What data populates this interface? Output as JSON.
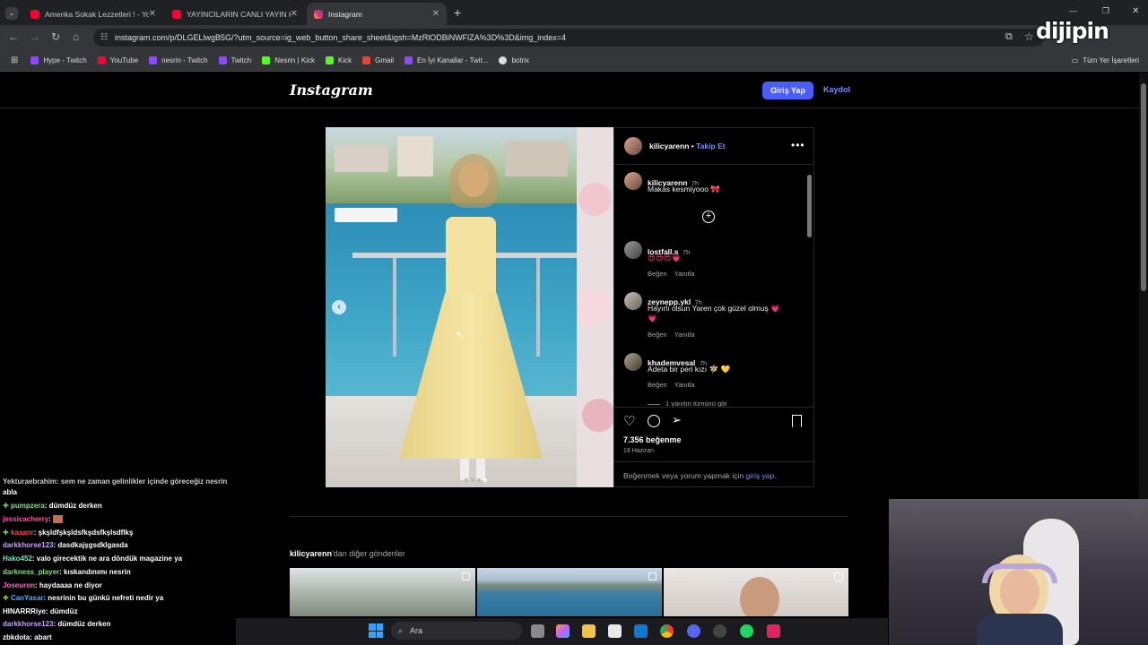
{
  "browser": {
    "tabs": [
      {
        "title": "Amerika Sokak Lezzetleri ! - You",
        "favicon_color": "#ff0033"
      },
      {
        "title": "YAYINCILARIN CANLI YAYIN KAZ",
        "favicon_color": "#ff0033"
      },
      {
        "title": "Instagram",
        "favicon_color": "#e1306c"
      }
    ],
    "url": "instagram.com/p/DLGELlwgB5G/?utm_source=ig_web_button_share_sheet&igsh=MzRlODBiNWFlZA%3D%3D&img_index=4",
    "bookmarks": [
      {
        "label": "Hype - Twitch",
        "color": "#9146ff"
      },
      {
        "label": "YouTube",
        "color": "#ff0033"
      },
      {
        "label": "nesrin - Twitch",
        "color": "#9146ff"
      },
      {
        "label": "Twitch",
        "color": "#9146ff"
      },
      {
        "label": "Nesrin | Kick",
        "color": "#53fc18"
      },
      {
        "label": "Kick",
        "color": "#53fc18"
      },
      {
        "label": "Gmail",
        "color": "#ea4335"
      },
      {
        "label": "En İyi Kanallar - Twit...",
        "color": "#9146ff"
      },
      {
        "label": "botrix",
        "color": "#dddddd"
      }
    ],
    "all_bookmarks": "Tüm Yer İşaretleri",
    "watermark": "dijipin"
  },
  "instagram": {
    "logo": "Instagram",
    "login_label": "Giriş Yap",
    "signup_label": "Kaydol",
    "post": {
      "username": "kilicyarenn",
      "follow_label": "Takip Et",
      "caption": {
        "user": "kilicyarenn",
        "time": "7h",
        "text": "Makas kesmiyooo 🎀"
      },
      "comments": [
        {
          "user": "lostfall.s",
          "time": "7h",
          "text": "😍😍😍💗",
          "like_label": "Beğen",
          "reply_label": "Yanıtla"
        },
        {
          "user": "zeynepp.ykl",
          "time": "7h",
          "text": "Hayırlı olsun Yaren çok güzel olmuş 💗",
          "text2": "💗",
          "like_label": "Beğen",
          "reply_label": "Yanıtla"
        },
        {
          "user": "khademvesal",
          "time": "7h",
          "text": "Adeta bir peri kızı 🧚 💛",
          "like_label": "Beğen",
          "reply_label": "Yanıtla"
        }
      ],
      "view_replies": "1 yanıtın tümünü gör",
      "likes": "7.356 beğenme",
      "date": "19 Haziran",
      "login_prompt": "Beğenmek veya yorum yapmak için",
      "login_link": "giriş yap",
      "login_period": "."
    },
    "more_posts": {
      "user": "kilicyarenn",
      "suffix": "'dan diğer gönderiler"
    }
  },
  "chat": [
    {
      "user": "Yekturaebrahim",
      "msg": ": sem ne zaman gelinlikler içinde göreceğiz nesrin",
      "user_color": "#ffffff"
    },
    {
      "user": "",
      "msg": "abla",
      "user_color": "#ffffff"
    },
    {
      "user": "pumpzera",
      "msg": ": dümdüz derken",
      "user_color": "#7fe07f"
    },
    {
      "user": "jessicacherry",
      "msg": ": ",
      "user_color": "#ff4fa3"
    },
    {
      "user": "kaaanr",
      "msg": ": şkşldfşkşldsfkşdsfkşlsdflkş",
      "user_color": "#ff4444"
    },
    {
      "user": "darkkhorse123",
      "msg": ": dasdkajşgsdklgasda",
      "user_color": "#c9a0ff"
    },
    {
      "user": "Hako452",
      "msg": ": valo girecektik ne ara döndük magazine ya",
      "user_color": "#7fe0c0"
    },
    {
      "user": "darkness_player",
      "msg": ": kıskandınımı nesrin",
      "user_color": "#7fe07f"
    },
    {
      "user": "Joseuron",
      "msg": ": haydaaaa ne diyor",
      "user_color": "#ff66cc"
    },
    {
      "user": "CanYasar",
      "msg": ": nesrinin bu günkü nefreti nedir ya",
      "user_color": "#55aaff"
    },
    {
      "user": "HINARRRiye",
      "msg": ": dümdüz",
      "user_color": "#ffffff"
    },
    {
      "user": "darkkhorse123",
      "msg": ": dümdüz derken",
      "user_color": "#c9a0ff"
    },
    {
      "user": "zbkdota",
      "msg": ": abart",
      "user_color": "#ffffff"
    }
  ],
  "taskbar": {
    "search_placeholder": "Ara"
  }
}
